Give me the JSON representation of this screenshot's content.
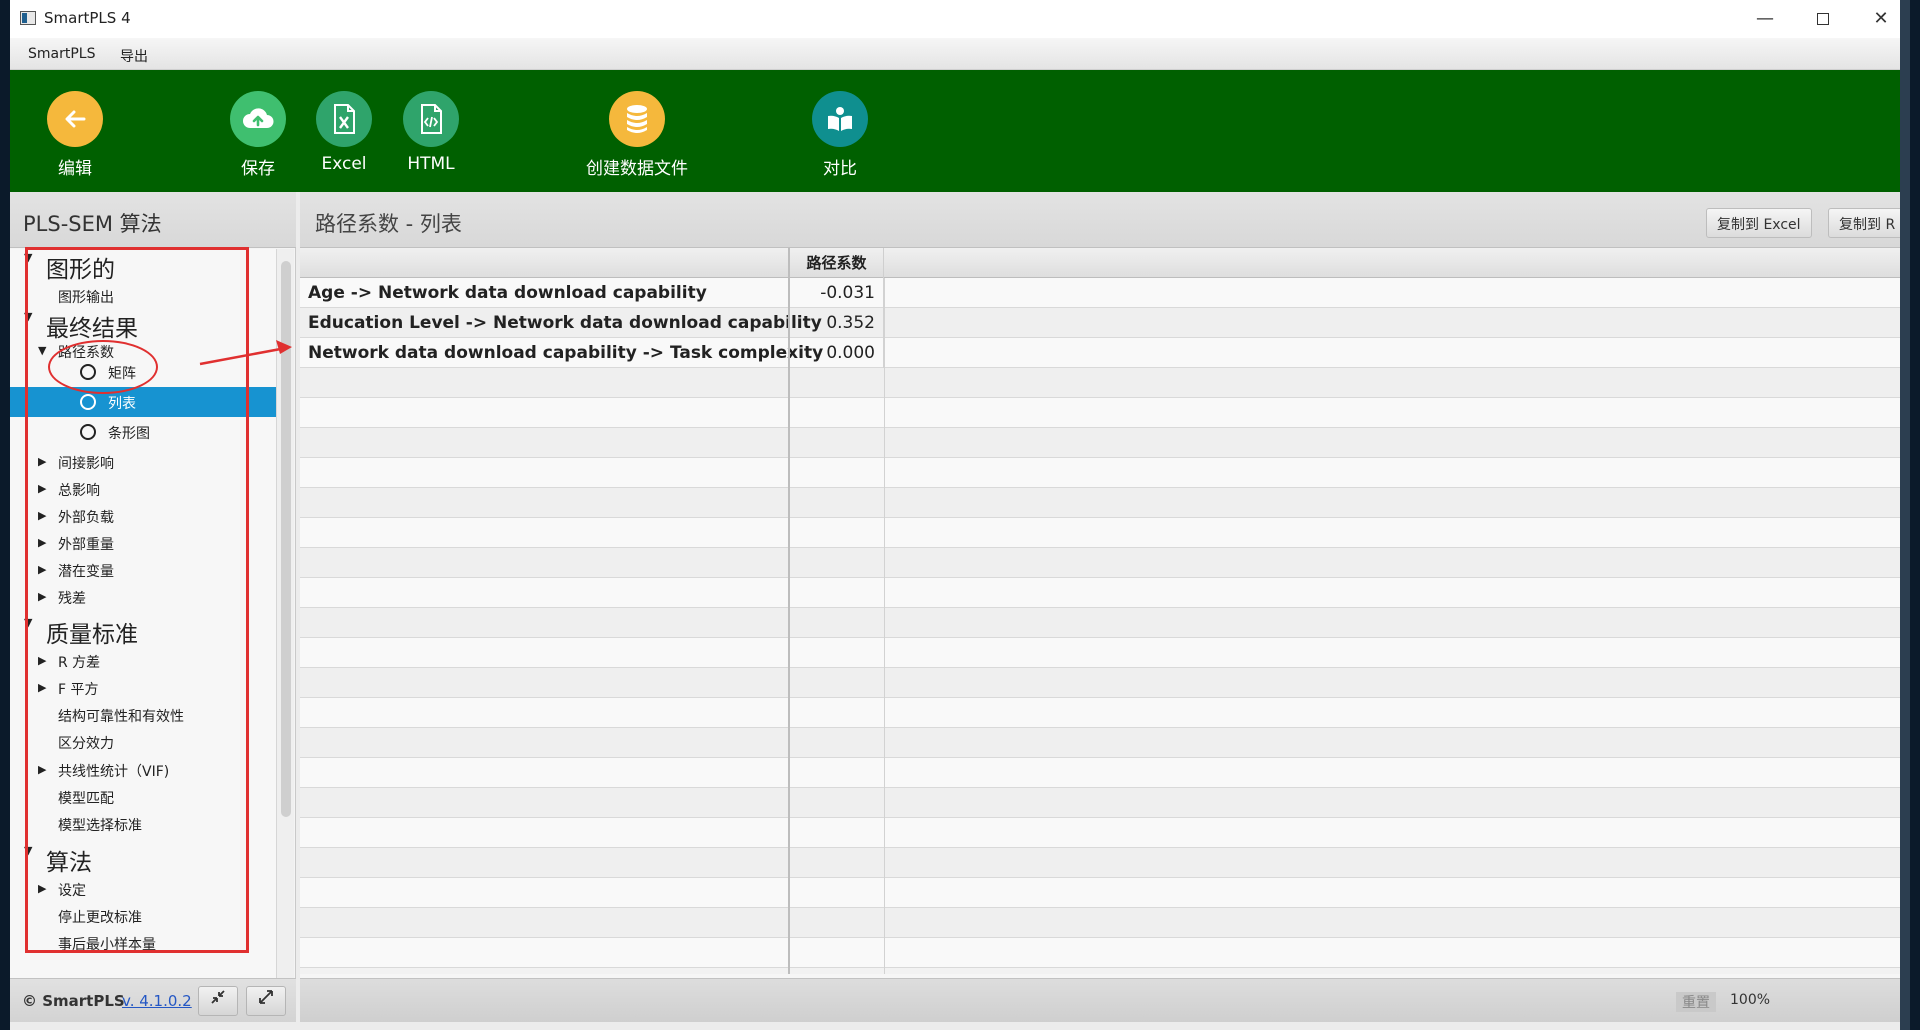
{
  "window": {
    "title": "SmartPLS 4",
    "min_symbol": "—",
    "close_symbol": "✕"
  },
  "menu": {
    "items": [
      "SmartPLS",
      "导出"
    ]
  },
  "toolbar": {
    "edit": "编辑",
    "save": "保存",
    "excel": "Excel",
    "html": "HTML",
    "create_data_file": "创建数据文件",
    "compare": "对比"
  },
  "left_panel": {
    "title": "PLS-SEM 算法",
    "tree": {
      "graphical": "图形的",
      "graphical_output": "图形输出",
      "final_results": "最终结果",
      "path_coefficients": "路径系数",
      "matrix": "矩阵",
      "list": "列表",
      "bar_chart": "条形图",
      "indirect_effects": "间接影响",
      "total_effects": "总影响",
      "outer_loadings": "外部负载",
      "outer_weights": "外部重量",
      "latent_variables": "潜在变量",
      "residuals": "残差",
      "quality_criteria": "质量标准",
      "r_square": "R 方差",
      "f_square": "F 平方",
      "construct_reliability": "结构可靠性和有效性",
      "discriminant_validity": "区分效力",
      "collinearity": "共线性统计（VIF)",
      "model_fit": "模型匹配",
      "model_selection": "模型选择标准",
      "algorithm": "算法",
      "settings": "设定",
      "stop_criterion": "停止更改标准",
      "min_sample_size": "事后最小样本量"
    },
    "footer": {
      "copyright": "© SmartPLS",
      "version": "v. 4.1.0.2"
    }
  },
  "right_panel": {
    "title": "路径系数 - 列表",
    "copy_excel": "复制到 Excel",
    "copy_r": "复制到 R",
    "column_header": "路径系数",
    "rows": [
      {
        "path": "Age -> Network data download capability",
        "value": "-0.031"
      },
      {
        "path": "Education Level -> Network data download capability",
        "value": "0.352"
      },
      {
        "path": "Network data download capability -> Task complexity",
        "value": "0.000"
      }
    ],
    "status": {
      "reset": "重置",
      "zoom": "100%"
    }
  },
  "colors": {
    "toolbar_green": "#006000",
    "selection_blue": "#1793d1",
    "annotation_red": "#e03030"
  },
  "icons": [
    "back-arrow-icon",
    "cloud-upload-icon",
    "excel-file-icon",
    "html-file-icon",
    "database-icon",
    "compare-book-icon",
    "collapse-icon",
    "expand-icon"
  ]
}
